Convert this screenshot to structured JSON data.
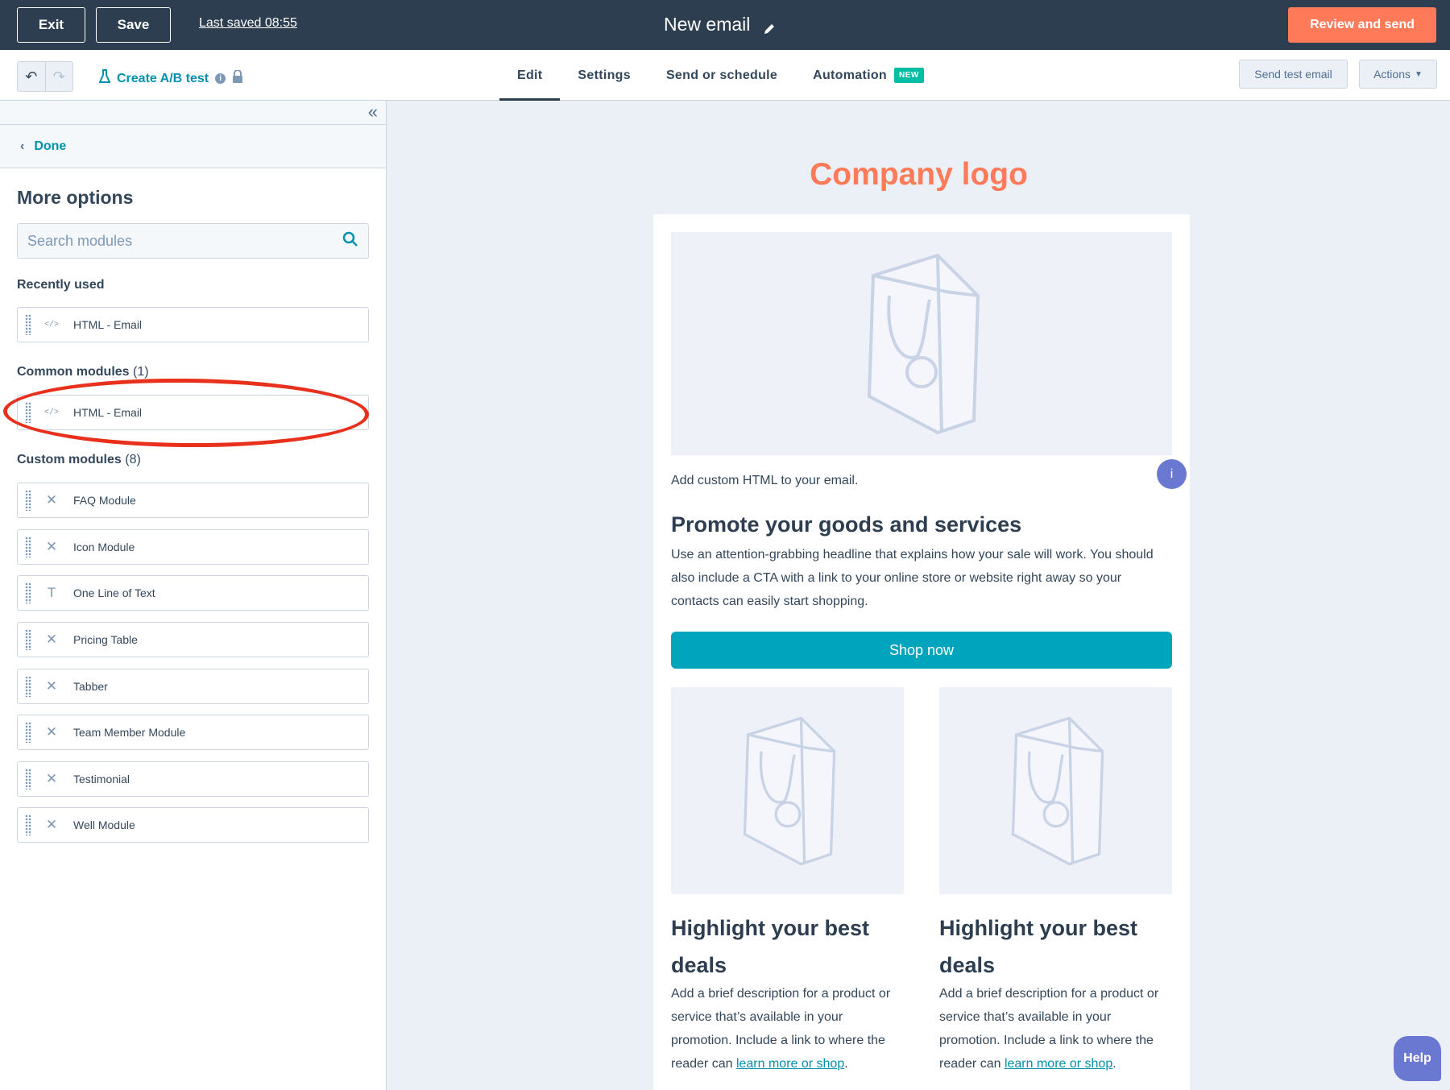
{
  "topbar": {
    "exit_label": "Exit",
    "save_label": "Save",
    "last_saved": "Last saved 08:55",
    "title": "New email",
    "review_label": "Review and send"
  },
  "subbar": {
    "ab_test_label": "Create A/B test",
    "tabs": [
      {
        "label": "Edit",
        "active": true
      },
      {
        "label": "Settings"
      },
      {
        "label": "Send or schedule"
      },
      {
        "label": "Automation",
        "badge": "NEW"
      }
    ],
    "send_test_label": "Send test email",
    "actions_label": "Actions"
  },
  "sidebar": {
    "done_label": "Done",
    "title": "More options",
    "search_placeholder": "Search modules",
    "recently_used_label": "Recently used",
    "recently_used": [
      {
        "label": "HTML - Email",
        "icon": "code-icon"
      }
    ],
    "common_label": "Common modules",
    "common_count": "(1)",
    "common": [
      {
        "label": "HTML - Email",
        "icon": "code-icon"
      }
    ],
    "custom_label": "Custom modules",
    "custom_count": "(8)",
    "custom": [
      {
        "label": "FAQ Module",
        "icon": "cross-icon"
      },
      {
        "label": "Icon Module",
        "icon": "cross-icon"
      },
      {
        "label": "One Line of Text",
        "icon": "text-icon"
      },
      {
        "label": "Pricing Table",
        "icon": "cross-icon"
      },
      {
        "label": "Tabber",
        "icon": "cross-icon"
      },
      {
        "label": "Team Member Module",
        "icon": "cross-icon"
      },
      {
        "label": "Testimonial",
        "icon": "cross-icon"
      },
      {
        "label": "Well Module",
        "icon": "cross-icon"
      }
    ]
  },
  "email": {
    "logo_text": "Company logo",
    "html_caption": "Add custom HTML to your email.",
    "info_badge": "i",
    "promo_heading": "Promote your goods and services",
    "promo_text": "Use an attention-grabbing headline that explains how your sale will work. You should also include a CTA with a link to your online store or website right away so your contacts can easily start shopping.",
    "shop_label": "Shop now",
    "deals": [
      {
        "heading": "Highlight your best deals",
        "text": "Add a brief description for a product or service that’s available in your promotion. Include a link to where the reader can ",
        "link": "learn more or shop",
        "after_link": "."
      },
      {
        "heading": "Highlight your best deals",
        "text": "Add a brief description for a product or service that’s available in your promotion. Include a link to where the reader can ",
        "link": "learn more or shop",
        "after_link": "."
      }
    ]
  },
  "help_label": "Help",
  "colors": {
    "topbar": "#2d3e50",
    "accent": "#ff7a59",
    "link": "#0091ae",
    "cta": "#00a4bd",
    "highlight": "#e8301c"
  }
}
